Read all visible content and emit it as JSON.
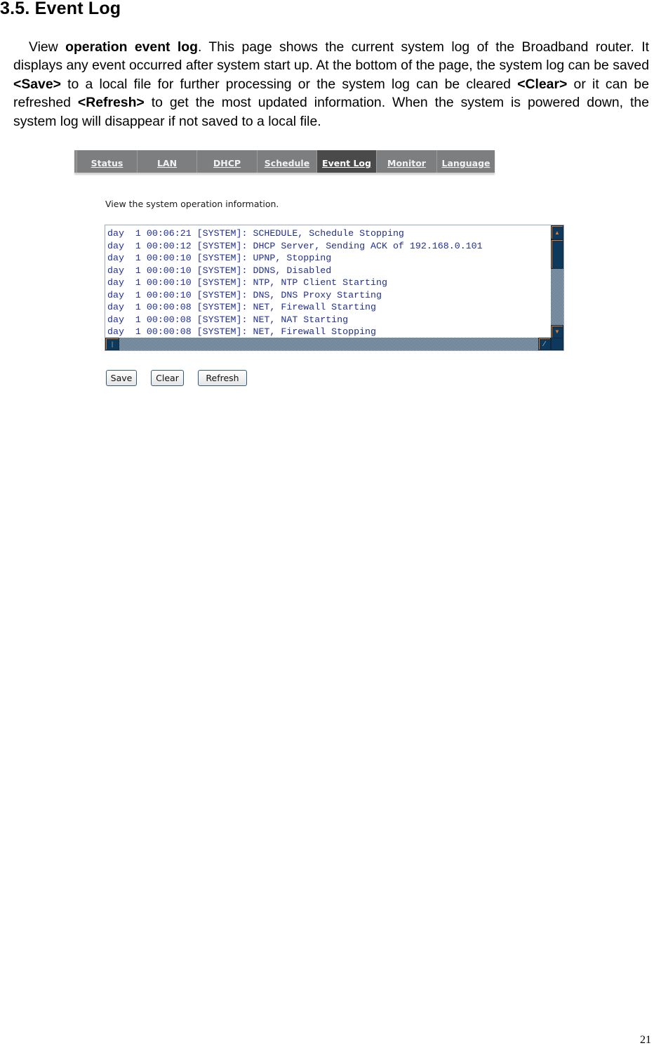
{
  "section": {
    "heading": "3.5. Event Log",
    "paragraph": [
      {
        "text": "View ",
        "bold": false
      },
      {
        "text": "operation event log",
        "bold": true
      },
      {
        "text": ". This page shows the current system log of the Broadband router. It displays any event occurred after system start up. At the bottom of the page, the system log can be saved ",
        "bold": false
      },
      {
        "text": "<Save>",
        "bold": true
      },
      {
        "text": " to a local file for further processing or the system log can be cleared ",
        "bold": false
      },
      {
        "text": "<Clear>",
        "bold": true
      },
      {
        "text": " or it can be refreshed ",
        "bold": false
      },
      {
        "text": "<Refresh>",
        "bold": true
      },
      {
        "text": " to get the most updated information. When the system is powered down, the system log will disappear if not saved to a local file.",
        "bold": false
      }
    ]
  },
  "router_ui": {
    "tabs": [
      {
        "label": "Status",
        "active": false
      },
      {
        "label": "LAN",
        "active": false
      },
      {
        "label": "DHCP",
        "active": false
      },
      {
        "label": "Schedule",
        "active": false
      },
      {
        "label": "Event Log",
        "active": true
      },
      {
        "label": "Monitor",
        "active": false
      },
      {
        "label": "Language",
        "active": false
      }
    ],
    "info_text": "View the system operation information.",
    "log_lines": [
      "day  1 00:06:21 [SYSTEM]: SCHEDULE, Schedule Stopping",
      "day  1 00:00:12 [SYSTEM]: DHCP Server, Sending ACK of 192.168.0.101",
      "day  1 00:00:10 [SYSTEM]: UPNP, Stopping",
      "day  1 00:00:10 [SYSTEM]: DDNS, Disabled",
      "day  1 00:00:10 [SYSTEM]: NTP, NTP Client Starting",
      "day  1 00:00:10 [SYSTEM]: DNS, DNS Proxy Starting",
      "day  1 00:00:08 [SYSTEM]: NET, Firewall Starting",
      "day  1 00:00:08 [SYSTEM]: NET, NAT Starting",
      "day  1 00:00:08 [SYSTEM]: NET, Firewall Stopping"
    ],
    "buttons": {
      "save": "Save",
      "clear": "Clear",
      "refresh": "Refresh"
    },
    "icons": {
      "scroll_up": "▲",
      "scroll_down": "▼",
      "h_thumb": "|",
      "resize_grip": "⁄"
    }
  },
  "page_number": "21"
}
